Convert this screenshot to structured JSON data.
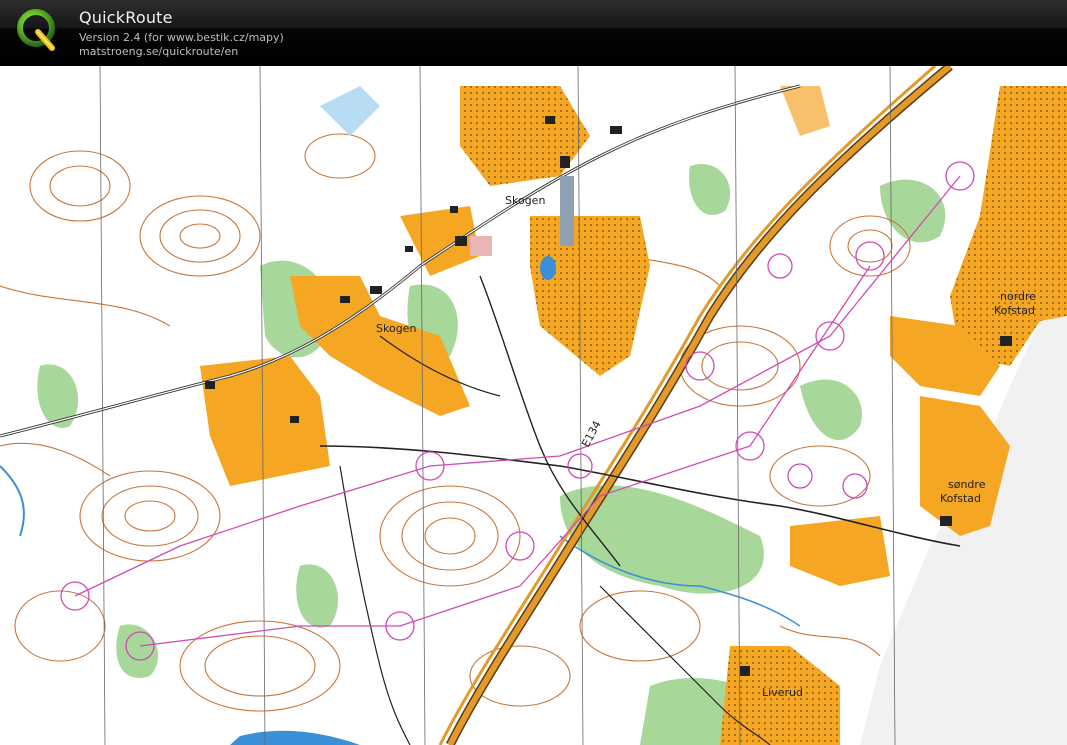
{
  "app": {
    "name": "QuickRoute",
    "version_line": "Version 2.4  (for www.bestik.cz/mapy)",
    "website": "matstroeng.se/quickroute/en",
    "logo_letter": "Q"
  },
  "map": {
    "labels": {
      "skogen_north": "Skogen",
      "skogen_west": "Skogen",
      "road_number": "E134",
      "nordre_line1": "nordre",
      "nordre_line2": "Kofstad",
      "sondre_line1": "søndre",
      "sondre_line2": "Kofstad",
      "liverud": "Liverud"
    },
    "colors": {
      "open_land": "#f5a623",
      "forest_white": "#ffffff",
      "green_vegetation": "#a8d79a",
      "contours": "#c8763a",
      "water": "#3b8fd6",
      "course": "#d04ab5",
      "road_major": "#e39a2a",
      "paper_background": "#f3f3f3"
    }
  }
}
